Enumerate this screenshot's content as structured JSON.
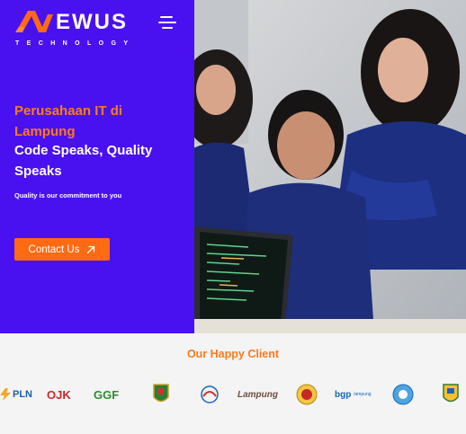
{
  "brand": {
    "name": "EWUS",
    "subtitle": "TECHNOLOGY",
    "primary_color": "#4a11f0",
    "accent_color": "#ff6a13"
  },
  "header": {
    "menu_icon": "hamburger-menu-icon"
  },
  "hero": {
    "tagline": "Perusahaan IT di Lampung",
    "headline": "Code Speaks, Quality Speaks",
    "subline": "Quality is our commitment to you",
    "cta_label": "Contact Us",
    "cta_icon": "arrow-up-right-icon"
  },
  "clients": {
    "title": "Our Happy Client",
    "logos": [
      {
        "label": "PLN"
      },
      {
        "label": "OJK"
      },
      {
        "label": "GGF"
      },
      {
        "label": "Lampung emblem"
      },
      {
        "label": "Pertamina"
      },
      {
        "label": "Lampung"
      },
      {
        "label": "Seal"
      },
      {
        "label": "bgp",
        "suffix": "lampung"
      },
      {
        "label": "Seal"
      },
      {
        "label": "Emblem"
      }
    ]
  }
}
